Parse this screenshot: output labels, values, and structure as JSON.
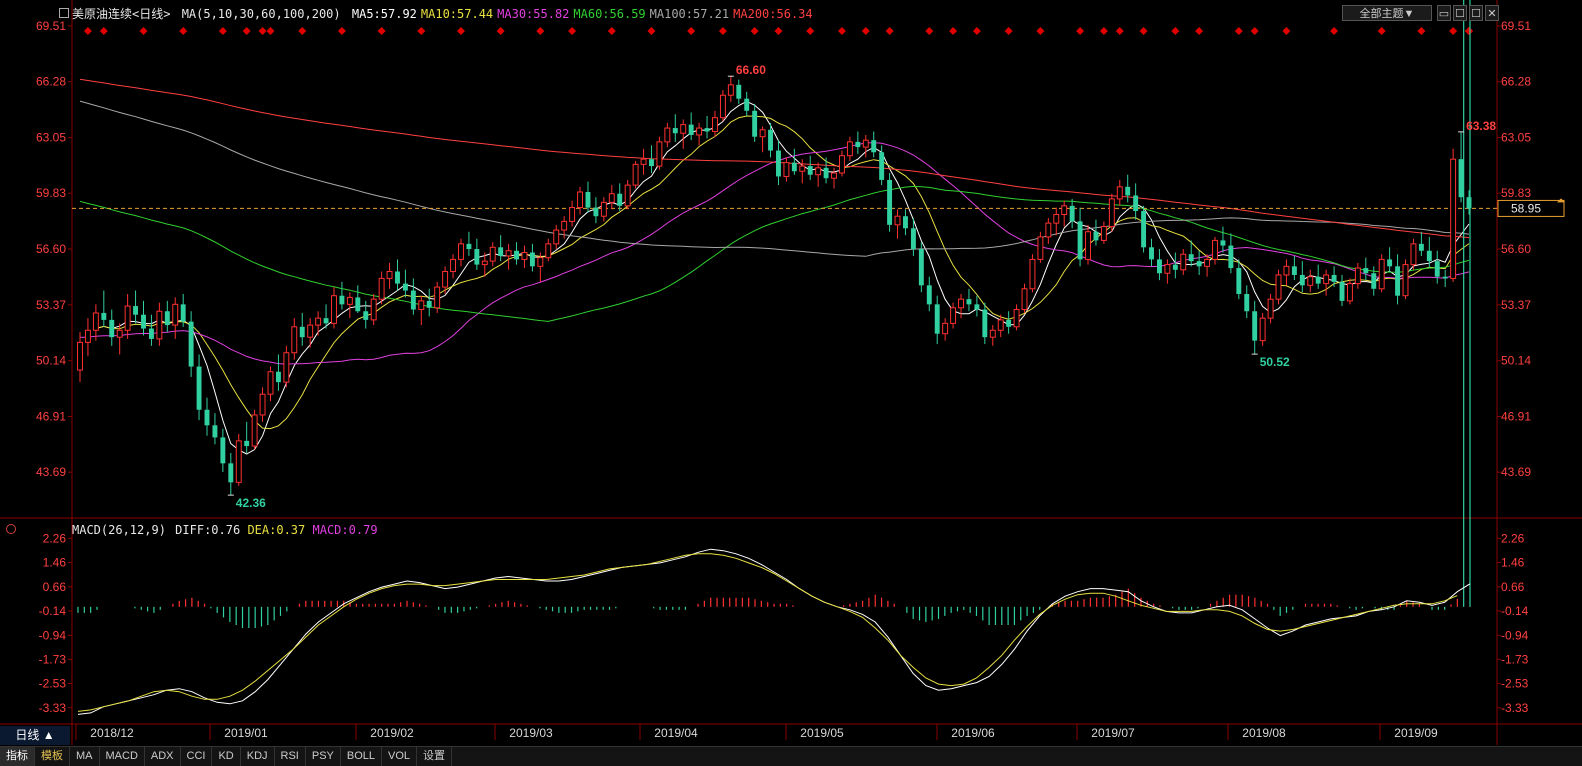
{
  "header": {
    "symbol": "美原油连续<日线>",
    "ma_params": "MA(5,10,30,60,100,200)",
    "ma": [
      {
        "label": "MA5",
        "value": "57.92",
        "color": "#ffffff"
      },
      {
        "label": "MA10",
        "value": "57.44",
        "color": "#e8e040"
      },
      {
        "label": "MA30",
        "value": "55.82",
        "color": "#e040e0"
      },
      {
        "label": "MA60",
        "value": "56.59",
        "color": "#30d030"
      },
      {
        "label": "MA100",
        "value": "57.21",
        "color": "#a8a8a8"
      },
      {
        "label": "MA200",
        "value": "56.34",
        "color": "#ff4040"
      }
    ]
  },
  "theme_button": "全部主题▼",
  "macd_header": {
    "params": "MACD(26,12,9)",
    "diff_label": "DIFF",
    "diff": "0.76",
    "dea_label": "DEA",
    "dea": "0.37",
    "macd_label": "MACD",
    "macd": "0.79"
  },
  "price_axis": [
    "69.51",
    "66.28",
    "63.05",
    "59.83",
    "56.60",
    "53.37",
    "50.14",
    "46.91",
    "43.69"
  ],
  "macd_axis": [
    "2.26",
    "1.46",
    "0.66",
    "-0.14",
    "-0.94",
    "-1.73",
    "-2.53",
    "-3.33"
  ],
  "current_price": "58.95",
  "annotations": {
    "high": "66.60",
    "low": "42.36",
    "recent_high": "63.38",
    "local_low": "50.52"
  },
  "date_axis": [
    "2018/12",
    "2019/01",
    "2019/02",
    "2019/03",
    "2019/04",
    "2019/05",
    "2019/06",
    "2019/07",
    "2019/08",
    "2019/09"
  ],
  "cycle_label": "日线 ▲",
  "bottom_tabs": [
    "指标",
    "模板",
    "MA",
    "MACD",
    "ADX",
    "CCI",
    "KD",
    "KDJ",
    "RSI",
    "PSY",
    "BOLL",
    "VOL",
    "设置"
  ],
  "colors": {
    "up": "#ff3030",
    "down": "#30d0a0",
    "axis_text": "#ff4040",
    "grid": "#8a0000",
    "bg": "#000000",
    "diamond": "#e00000"
  },
  "chart_data": {
    "type": "candlestick",
    "price_range": [
      41.5,
      70.2
    ],
    "macd_range": [
      -3.8,
      2.6
    ],
    "diamond_markers": 48,
    "ohlc": [
      [
        49.6,
        51.8,
        48.9,
        51.2
      ],
      [
        51.2,
        52.6,
        50.4,
        51.9
      ],
      [
        51.9,
        53.4,
        51.3,
        52.9
      ],
      [
        52.9,
        54.2,
        52.1,
        52.5
      ],
      [
        52.5,
        53.1,
        51.0,
        51.5
      ],
      [
        51.5,
        52.3,
        50.5,
        51.9
      ],
      [
        51.9,
        54.0,
        51.4,
        53.3
      ],
      [
        53.3,
        54.2,
        52.3,
        52.8
      ],
      [
        52.8,
        53.6,
        51.6,
        52.0
      ],
      [
        52.0,
        52.8,
        51.0,
        51.4
      ],
      [
        51.4,
        53.5,
        51.0,
        53.0
      ],
      [
        53.0,
        53.6,
        51.8,
        52.2
      ],
      [
        52.2,
        53.8,
        51.4,
        53.4
      ],
      [
        53.4,
        54.0,
        52.1,
        52.4
      ],
      [
        52.4,
        53.0,
        49.2,
        49.8
      ],
      [
        49.8,
        50.5,
        46.7,
        47.3
      ],
      [
        47.3,
        48.0,
        45.8,
        46.4
      ],
      [
        46.4,
        47.1,
        45.3,
        45.7
      ],
      [
        45.7,
        46.2,
        43.7,
        44.2
      ],
      [
        44.2,
        44.8,
        42.36,
        43.1
      ],
      [
        43.1,
        45.9,
        42.9,
        45.5
      ],
      [
        45.5,
        46.6,
        44.8,
        45.2
      ],
      [
        45.2,
        47.3,
        45.0,
        47.0
      ],
      [
        47.0,
        48.6,
        46.6,
        48.2
      ],
      [
        48.2,
        49.8,
        47.8,
        49.5
      ],
      [
        49.5,
        50.5,
        48.4,
        48.9
      ],
      [
        48.9,
        51.0,
        48.6,
        50.6
      ],
      [
        50.6,
        52.6,
        50.2,
        52.1
      ],
      [
        52.1,
        52.9,
        51.0,
        51.5
      ],
      [
        51.5,
        52.6,
        50.9,
        52.2
      ],
      [
        52.2,
        53.0,
        51.6,
        52.6
      ],
      [
        52.6,
        53.4,
        52.0,
        52.3
      ],
      [
        52.3,
        54.4,
        52.0,
        53.9
      ],
      [
        53.9,
        54.7,
        53.1,
        53.4
      ],
      [
        53.4,
        54.1,
        52.6,
        53.8
      ],
      [
        53.8,
        54.5,
        52.9,
        53.0
      ],
      [
        53.0,
        53.6,
        52.0,
        52.5
      ],
      [
        52.5,
        54.0,
        52.2,
        53.7
      ],
      [
        53.7,
        55.3,
        53.4,
        54.9
      ],
      [
        54.9,
        55.8,
        54.3,
        55.3
      ],
      [
        55.3,
        56.0,
        54.2,
        54.6
      ],
      [
        54.6,
        55.4,
        53.8,
        54.2
      ],
      [
        54.2,
        54.9,
        52.8,
        53.1
      ],
      [
        53.1,
        53.9,
        52.2,
        53.6
      ],
      [
        53.6,
        54.3,
        52.7,
        53.2
      ],
      [
        53.2,
        54.7,
        52.9,
        54.4
      ],
      [
        54.4,
        55.6,
        54.0,
        55.3
      ],
      [
        55.3,
        56.3,
        54.9,
        56.0
      ],
      [
        56.0,
        57.2,
        55.6,
        56.9
      ],
      [
        56.9,
        57.6,
        56.2,
        56.6
      ],
      [
        56.6,
        57.2,
        55.4,
        55.7
      ],
      [
        55.7,
        56.4,
        55.0,
        55.9
      ],
      [
        55.9,
        57.0,
        55.6,
        56.7
      ],
      [
        56.7,
        57.4,
        55.9,
        56.2
      ],
      [
        56.2,
        56.9,
        55.4,
        56.5
      ],
      [
        56.5,
        57.0,
        55.7,
        56.0
      ],
      [
        56.0,
        56.8,
        55.5,
        56.4
      ],
      [
        56.4,
        56.9,
        55.3,
        55.6
      ],
      [
        55.6,
        56.4,
        54.7,
        56.1
      ],
      [
        56.1,
        57.2,
        55.9,
        56.9
      ],
      [
        56.9,
        58.0,
        56.6,
        57.7
      ],
      [
        57.7,
        58.5,
        57.2,
        58.2
      ],
      [
        58.2,
        59.4,
        57.9,
        59.0
      ],
      [
        59.0,
        60.2,
        58.6,
        59.9
      ],
      [
        59.9,
        60.5,
        58.7,
        59.0
      ],
      [
        59.0,
        59.6,
        58.1,
        58.5
      ],
      [
        58.5,
        59.6,
        58.2,
        59.3
      ],
      [
        59.3,
        60.3,
        58.9,
        59.8
      ],
      [
        59.8,
        60.4,
        58.8,
        59.1
      ],
      [
        59.1,
        60.6,
        58.9,
        60.3
      ],
      [
        60.3,
        61.7,
        60.1,
        61.5
      ],
      [
        61.5,
        62.4,
        60.9,
        61.8
      ],
      [
        61.8,
        62.6,
        61.0,
        61.4
      ],
      [
        61.4,
        63.1,
        61.2,
        62.8
      ],
      [
        62.8,
        63.9,
        62.5,
        63.6
      ],
      [
        63.6,
        64.4,
        62.8,
        63.3
      ],
      [
        63.3,
        64.1,
        62.4,
        63.8
      ],
      [
        63.8,
        64.5,
        62.9,
        63.2
      ],
      [
        63.2,
        63.9,
        62.6,
        63.6
      ],
      [
        63.6,
        64.3,
        63.0,
        63.4
      ],
      [
        63.4,
        64.6,
        63.1,
        64.2
      ],
      [
        64.2,
        65.8,
        64.0,
        65.5
      ],
      [
        65.5,
        66.6,
        65.1,
        66.1
      ],
      [
        66.1,
        66.4,
        65.0,
        65.3
      ],
      [
        65.3,
        65.7,
        64.3,
        64.6
      ],
      [
        64.6,
        65.0,
        62.8,
        63.1
      ],
      [
        63.1,
        63.7,
        62.2,
        63.5
      ],
      [
        63.5,
        63.9,
        61.9,
        62.3
      ],
      [
        62.3,
        62.9,
        60.3,
        60.8
      ],
      [
        60.8,
        61.9,
        60.5,
        61.6
      ],
      [
        61.6,
        62.4,
        60.9,
        61.1
      ],
      [
        61.1,
        61.8,
        60.4,
        61.4
      ],
      [
        61.4,
        62.0,
        60.6,
        60.9
      ],
      [
        60.9,
        61.6,
        60.2,
        61.3
      ],
      [
        61.3,
        61.9,
        60.4,
        60.7
      ],
      [
        60.7,
        61.3,
        60.1,
        61.0
      ],
      [
        61.0,
        62.3,
        60.8,
        62.0
      ],
      [
        62.0,
        63.1,
        61.7,
        62.8
      ],
      [
        62.8,
        63.4,
        62.1,
        62.5
      ],
      [
        62.5,
        63.2,
        61.9,
        62.9
      ],
      [
        62.9,
        63.4,
        61.9,
        62.2
      ],
      [
        62.2,
        62.6,
        60.3,
        60.6
      ],
      [
        60.6,
        61.0,
        57.6,
        58.0
      ],
      [
        58.0,
        58.9,
        57.2,
        58.5
      ],
      [
        58.5,
        58.9,
        57.4,
        57.8
      ],
      [
        57.8,
        58.4,
        56.2,
        56.6
      ],
      [
        56.6,
        57.0,
        54.1,
        54.5
      ],
      [
        54.5,
        55.0,
        53.0,
        53.4
      ],
      [
        53.4,
        53.9,
        51.1,
        51.7
      ],
      [
        51.7,
        52.6,
        51.3,
        52.3
      ],
      [
        52.3,
        53.5,
        52.0,
        53.2
      ],
      [
        53.2,
        54.0,
        52.6,
        53.7
      ],
      [
        53.7,
        54.3,
        53.0,
        53.4
      ],
      [
        53.4,
        53.9,
        52.7,
        53.1
      ],
      [
        53.1,
        53.5,
        51.1,
        51.5
      ],
      [
        51.5,
        52.2,
        51.0,
        51.9
      ],
      [
        51.9,
        52.8,
        51.5,
        52.5
      ],
      [
        52.5,
        53.0,
        51.7,
        52.1
      ],
      [
        52.1,
        53.4,
        51.9,
        53.1
      ],
      [
        53.1,
        54.6,
        52.9,
        54.3
      ],
      [
        54.3,
        56.3,
        54.1,
        56.0
      ],
      [
        56.0,
        57.6,
        55.8,
        57.3
      ],
      [
        57.3,
        58.4,
        56.9,
        58.1
      ],
      [
        58.1,
        59.0,
        57.4,
        58.6
      ],
      [
        58.6,
        59.4,
        57.9,
        59.1
      ],
      [
        59.1,
        59.5,
        57.8,
        58.2
      ],
      [
        58.2,
        59.0,
        55.6,
        56.0
      ],
      [
        56.0,
        58.0,
        55.7,
        57.6
      ],
      [
        57.6,
        58.3,
        56.8,
        57.1
      ],
      [
        57.1,
        58.2,
        56.9,
        57.9
      ],
      [
        57.9,
        59.8,
        57.6,
        59.5
      ],
      [
        59.5,
        60.6,
        59.1,
        60.2
      ],
      [
        60.2,
        60.9,
        59.3,
        59.7
      ],
      [
        59.7,
        60.4,
        58.3,
        58.8
      ],
      [
        58.8,
        59.1,
        56.4,
        56.7
      ],
      [
        56.7,
        57.2,
        55.6,
        56.0
      ],
      [
        56.0,
        56.6,
        54.8,
        55.2
      ],
      [
        55.2,
        56.0,
        54.6,
        55.7
      ],
      [
        55.7,
        56.4,
        54.9,
        55.4
      ],
      [
        55.4,
        56.6,
        55.1,
        56.3
      ],
      [
        56.3,
        57.1,
        55.6,
        55.9
      ],
      [
        55.9,
        56.5,
        55.1,
        55.6
      ],
      [
        55.6,
        56.3,
        55.0,
        56.0
      ],
      [
        56.0,
        57.3,
        55.7,
        57.1
      ],
      [
        57.1,
        57.9,
        56.4,
        56.8
      ],
      [
        56.8,
        57.5,
        55.2,
        55.5
      ],
      [
        55.5,
        56.0,
        53.7,
        54.0
      ],
      [
        54.0,
        54.5,
        52.6,
        53.0
      ],
      [
        53.0,
        53.6,
        50.52,
        51.3
      ],
      [
        51.3,
        52.9,
        51.0,
        52.6
      ],
      [
        52.6,
        54.0,
        52.3,
        53.7
      ],
      [
        53.7,
        55.4,
        53.4,
        55.1
      ],
      [
        55.1,
        56.0,
        54.5,
        55.6
      ],
      [
        55.6,
        56.2,
        54.8,
        55.1
      ],
      [
        55.1,
        55.9,
        54.1,
        54.5
      ],
      [
        54.5,
        55.4,
        54.1,
        55.0
      ],
      [
        55.0,
        55.7,
        54.3,
        54.6
      ],
      [
        54.6,
        55.4,
        53.9,
        55.1
      ],
      [
        55.1,
        55.6,
        54.4,
        54.7
      ],
      [
        54.7,
        55.1,
        53.3,
        53.6
      ],
      [
        53.6,
        54.9,
        53.4,
        54.6
      ],
      [
        54.6,
        55.8,
        54.3,
        55.5
      ],
      [
        55.5,
        56.1,
        54.8,
        55.2
      ],
      [
        55.2,
        55.6,
        53.9,
        54.3
      ],
      [
        54.3,
        56.3,
        54.1,
        56.0
      ],
      [
        56.0,
        56.7,
        55.3,
        55.6
      ],
      [
        55.6,
        56.3,
        53.4,
        53.9
      ],
      [
        53.9,
        56.0,
        53.7,
        55.7
      ],
      [
        55.7,
        57.2,
        55.4,
        56.9
      ],
      [
        56.9,
        57.6,
        56.2,
        56.5
      ],
      [
        56.5,
        57.3,
        55.5,
        55.9
      ],
      [
        55.9,
        56.5,
        54.6,
        55.0
      ],
      [
        55.0,
        55.4,
        54.4,
        54.9
      ],
      [
        54.9,
        62.4,
        54.7,
        61.8
      ],
      [
        61.8,
        63.38,
        59.3,
        59.6
      ],
      [
        59.6,
        60.0,
        58.6,
        58.95
      ]
    ],
    "macd": {
      "diff": [
        -3.55,
        -3.5,
        -3.3,
        -3.2,
        -3.1,
        -3.0,
        -2.9,
        -2.75,
        -2.7,
        -2.8,
        -3.0,
        -3.15,
        -3.2,
        -3.1,
        -2.8,
        -2.4,
        -1.9,
        -1.4,
        -0.9,
        -0.5,
        -0.2,
        0.1,
        0.3,
        0.5,
        0.65,
        0.75,
        0.85,
        0.8,
        0.7,
        0.6,
        0.65,
        0.75,
        0.85,
        0.95,
        1.0,
        0.95,
        0.9,
        0.85,
        0.85,
        0.9,
        1.0,
        1.1,
        1.2,
        1.3,
        1.35,
        1.4,
        1.45,
        1.55,
        1.65,
        1.8,
        1.9,
        1.85,
        1.75,
        1.6,
        1.4,
        1.15,
        0.9,
        0.6,
        0.35,
        0.15,
        0.0,
        -0.1,
        -0.25,
        -0.5,
        -1.0,
        -1.6,
        -2.2,
        -2.6,
        -2.75,
        -2.7,
        -2.6,
        -2.5,
        -2.3,
        -1.9,
        -1.4,
        -0.8,
        -0.3,
        0.1,
        0.35,
        0.5,
        0.6,
        0.6,
        0.55,
        0.5,
        0.2,
        0.0,
        -0.15,
        -0.2,
        -0.2,
        -0.1,
        0.0,
        0.05,
        -0.1,
        -0.4,
        -0.7,
        -0.95,
        -0.8,
        -0.6,
        -0.5,
        -0.4,
        -0.35,
        -0.3,
        -0.15,
        -0.1,
        0.0,
        0.2,
        0.15,
        0.05,
        0.15,
        0.5,
        0.76
      ],
      "dea": [
        -3.45,
        -3.4,
        -3.3,
        -3.2,
        -3.1,
        -2.95,
        -2.8,
        -2.75,
        -2.8,
        -2.95,
        -3.05,
        -3.05,
        -2.95,
        -2.75,
        -2.45,
        -2.1,
        -1.75,
        -1.4,
        -1.0,
        -0.6,
        -0.3,
        0.0,
        0.25,
        0.45,
        0.6,
        0.7,
        0.75,
        0.75,
        0.7,
        0.7,
        0.75,
        0.8,
        0.85,
        0.9,
        0.9,
        0.9,
        0.9,
        0.9,
        0.95,
        1.0,
        1.05,
        1.15,
        1.25,
        1.3,
        1.35,
        1.4,
        1.5,
        1.6,
        1.7,
        1.75,
        1.75,
        1.7,
        1.6,
        1.45,
        1.3,
        1.1,
        0.85,
        0.6,
        0.35,
        0.15,
        0.0,
        -0.15,
        -0.35,
        -0.7,
        -1.1,
        -1.6,
        -2.0,
        -2.35,
        -2.55,
        -2.6,
        -2.55,
        -2.35,
        -2.0,
        -1.6,
        -1.1,
        -0.65,
        -0.25,
        0.05,
        0.25,
        0.4,
        0.45,
        0.45,
        0.35,
        0.2,
        0.05,
        -0.05,
        -0.15,
        -0.15,
        -0.15,
        -0.1,
        -0.1,
        -0.15,
        -0.3,
        -0.55,
        -0.75,
        -0.8,
        -0.75,
        -0.65,
        -0.55,
        -0.45,
        -0.35,
        -0.25,
        -0.15,
        -0.05,
        0.05,
        0.1,
        0.1,
        0.1,
        0.2,
        0.37
      ]
    }
  }
}
